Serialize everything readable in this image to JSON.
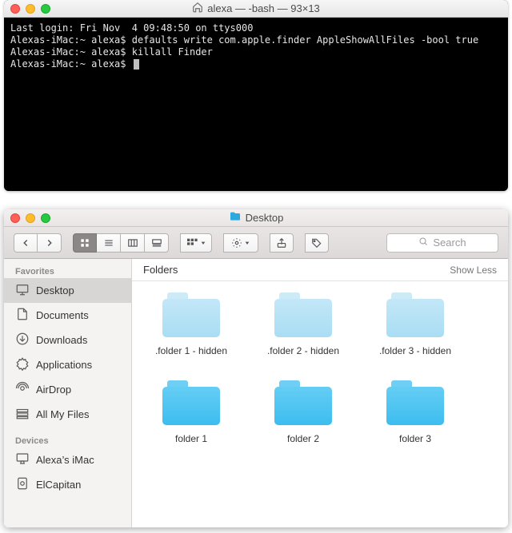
{
  "terminal": {
    "title": "alexa — -bash — 93×13",
    "lines": [
      "Last login: Fri Nov  4 09:48:50 on ttys000",
      "Alexas-iMac:~ alexa$ defaults write com.apple.finder AppleShowAllFiles -bool true",
      "Alexas-iMac:~ alexa$ killall Finder",
      "Alexas-iMac:~ alexa$ "
    ]
  },
  "finder": {
    "title": "Desktop",
    "search_placeholder": "Search",
    "sidebar": {
      "favorites_header": "Favorites",
      "devices_header": "Devices",
      "favorites": [
        {
          "label": "Desktop",
          "selected": true
        },
        {
          "label": "Documents",
          "selected": false
        },
        {
          "label": "Downloads",
          "selected": false
        },
        {
          "label": "Applications",
          "selected": false
        },
        {
          "label": "AirDrop",
          "selected": false
        },
        {
          "label": "All My Files",
          "selected": false
        }
      ],
      "devices": [
        {
          "label": "Alexa’s iMac"
        },
        {
          "label": "ElCapitan"
        }
      ]
    },
    "section": {
      "header": "Folders",
      "showless": "Show Less"
    },
    "folders_hidden": [
      ".folder 1 - hidden",
      ".folder 2 - hidden",
      ".folder 3 - hidden"
    ],
    "folders_normal": [
      "folder 1",
      "folder 2",
      "folder 3"
    ]
  }
}
